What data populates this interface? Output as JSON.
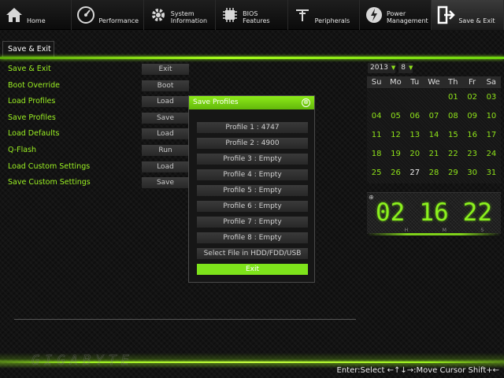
{
  "nav": {
    "tabs": [
      {
        "label": "Home",
        "icon": "home-icon"
      },
      {
        "label": "Performance",
        "icon": "speedometer-icon"
      },
      {
        "label": "System\nInformation",
        "icon": "gear-icon"
      },
      {
        "label": "BIOS\nFeatures",
        "icon": "chip-icon"
      },
      {
        "label": "Peripherals",
        "icon": "plug-icon"
      },
      {
        "label": "Power\nManagement",
        "icon": "power-icon"
      },
      {
        "label": "Save & Exit",
        "icon": "exit-door-icon",
        "active": true
      }
    ]
  },
  "section": {
    "title": "Save & Exit"
  },
  "menu": {
    "items": [
      {
        "label": "Save & Exit",
        "action": "Exit"
      },
      {
        "label": "Boot Override",
        "action": "Boot"
      },
      {
        "label": "Load Profiles",
        "action": "Load"
      },
      {
        "label": "Save Profiles",
        "action": "Save"
      },
      {
        "label": "Load Defaults",
        "action": "Load"
      },
      {
        "label": "Q-Flash",
        "action": "Run"
      },
      {
        "label": "Load Custom Settings",
        "action": "Load"
      },
      {
        "label": "Save Custom Settings",
        "action": "Save"
      }
    ]
  },
  "modal": {
    "title": "Save Profiles",
    "close_glyph": "⊗",
    "buttons": [
      "Profile 1 : 4747",
      "Profile 2 : 4900",
      "Profile 3 : Empty",
      "Profile 4 : Empty",
      "Profile 5 : Empty",
      "Profile 6 : Empty",
      "Profile 7 : Empty",
      "Profile 8 : Empty",
      "Select File in HDD/FDD/USB"
    ],
    "exit_label": "Exit"
  },
  "calendar": {
    "year": "2013",
    "month": "8",
    "weekdays": [
      "Su",
      "Mo",
      "Tu",
      "We",
      "Th",
      "Fr",
      "Sa"
    ],
    "days": [
      "",
      "",
      "",
      "",
      "01",
      "02",
      "03",
      "04",
      "05",
      "06",
      "07",
      "08",
      "09",
      "10",
      "11",
      "12",
      "13",
      "14",
      "15",
      "16",
      "17",
      "18",
      "19",
      "20",
      "21",
      "22",
      "23",
      "24",
      "25",
      "26",
      "27",
      "28",
      "29",
      "30",
      "31"
    ],
    "today": "27"
  },
  "clock": {
    "hours": "02",
    "minutes": "16",
    "seconds": "22",
    "h_label": "H",
    "m_label": "M",
    "s_label": "S"
  },
  "footer": {
    "help": "Enter:Select ←↑↓→:Move Cursor Shift+←"
  },
  "colors": {
    "accent": "#8fe31a",
    "menu_text": "#9bf023"
  }
}
